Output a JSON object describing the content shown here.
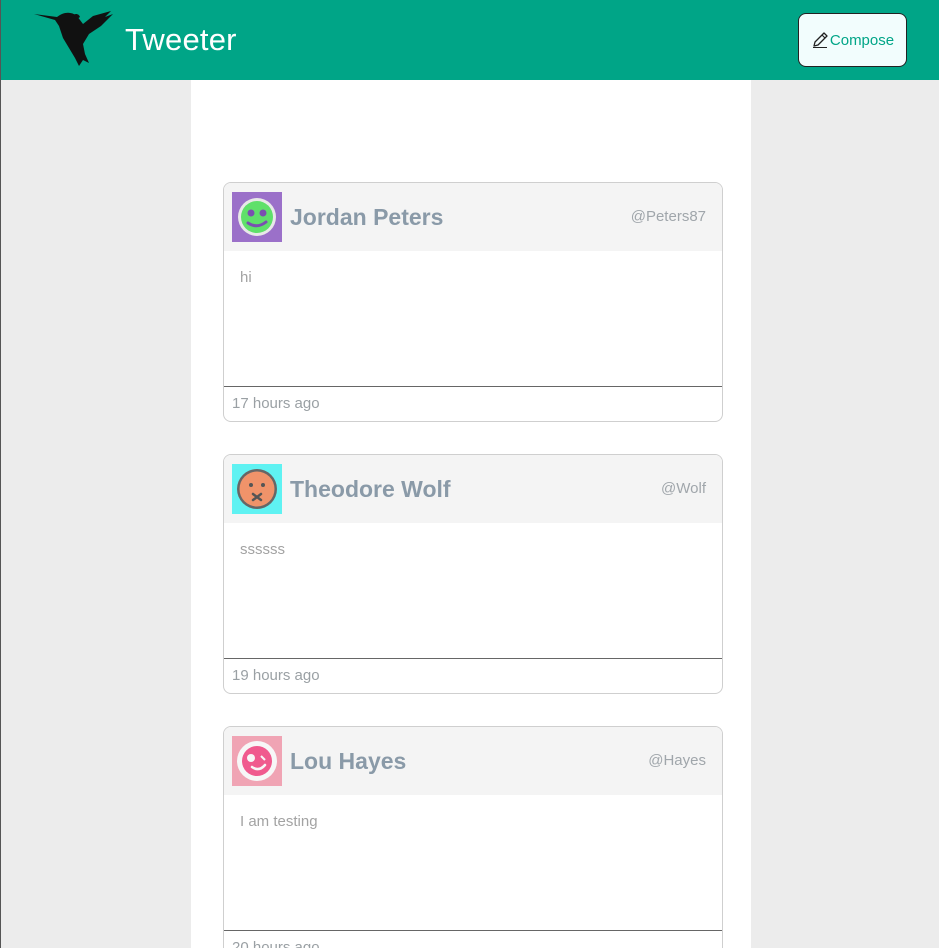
{
  "navbar": {
    "brand": "Tweeter",
    "compose_label": "Compose",
    "bg_color": "#00a587"
  },
  "tweets": [
    {
      "name": "Jordan Peters",
      "handle": "@Peters87",
      "text": "hi",
      "time": "17 hours ago",
      "avatar": {
        "bg": "#9b70c9",
        "face": "#5fe06a",
        "icon": "monster-avatar-icon"
      }
    },
    {
      "name": "Theodore Wolf",
      "handle": "@Wolf",
      "text": "ssssss",
      "time": "19 hours ago",
      "avatar": {
        "bg": "#5ff2f2",
        "face": "#f0936a",
        "icon": "monster-avatar-icon"
      }
    },
    {
      "name": "Lou Hayes",
      "handle": "@Hayes",
      "text": "I am testing",
      "time": "20 hours ago",
      "avatar": {
        "bg": "#f0a4b4",
        "face": "#f05a8e",
        "icon": "monster-avatar-icon"
      }
    }
  ]
}
